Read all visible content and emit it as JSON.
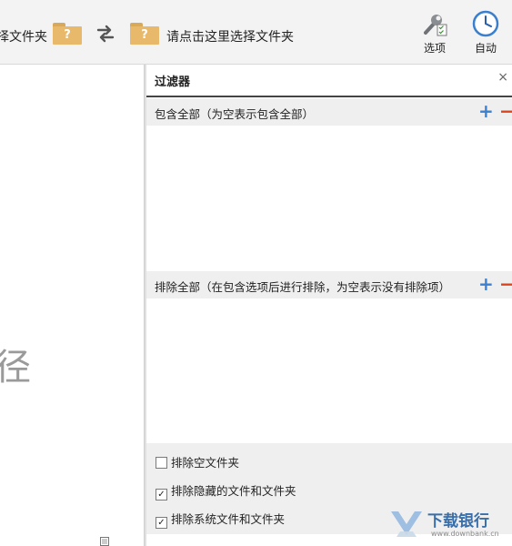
{
  "toolbar": {
    "left_folder_text": "择文件夹",
    "left_folder_badge": "?",
    "right_folder_badge": "?",
    "right_folder_text": "请点击这里选择文件夹",
    "options_label": "选项",
    "auto_label": "自动"
  },
  "left_pane": {
    "partial_char": "径"
  },
  "filter_panel": {
    "title": "过滤器",
    "close_glyph": "×",
    "include_section": {
      "label": "包含全部（为空表示包含全部）",
      "add_glyph": "+",
      "remove_glyph": "−"
    },
    "exclude_section": {
      "label": "排除全部（在包含选项后进行排除，为空表示没有排除项）",
      "add_glyph": "+",
      "remove_glyph": "−"
    },
    "options": [
      {
        "label": "排除空文件夹",
        "checked": false
      },
      {
        "label": "排除隐藏的文件和文件夹",
        "checked": true
      },
      {
        "label": "排除系统文件和文件夹",
        "checked": true
      }
    ]
  },
  "watermark": {
    "text": "下载银行",
    "sub": "www.downbank.cn"
  },
  "colors": {
    "accent_blue": "#3b7fcf",
    "remove_red": "#d9421a",
    "folder": "#e8b96a"
  }
}
